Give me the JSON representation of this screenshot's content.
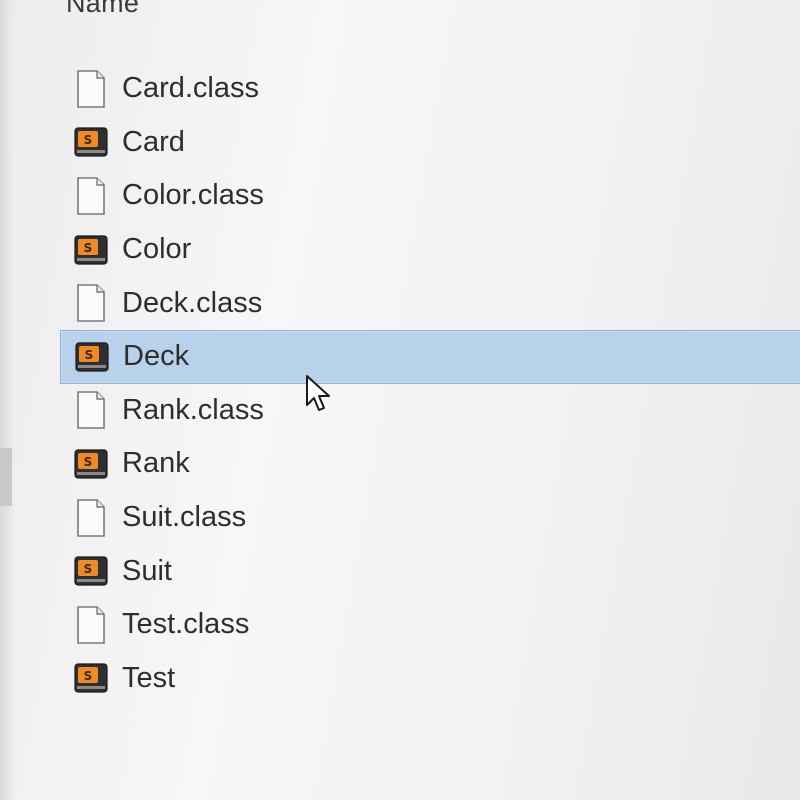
{
  "list_header": {
    "name_label": "Name"
  },
  "files": [
    {
      "name": "Card.class",
      "icon": "blank-file-icon",
      "selected": false
    },
    {
      "name": "Card",
      "icon": "sublime-file-icon",
      "selected": false
    },
    {
      "name": "Color.class",
      "icon": "blank-file-icon",
      "selected": false
    },
    {
      "name": "Color",
      "icon": "sublime-file-icon",
      "selected": false
    },
    {
      "name": "Deck.class",
      "icon": "blank-file-icon",
      "selected": false
    },
    {
      "name": "Deck",
      "icon": "sublime-file-icon",
      "selected": true
    },
    {
      "name": "Rank.class",
      "icon": "blank-file-icon",
      "selected": false
    },
    {
      "name": "Rank",
      "icon": "sublime-file-icon",
      "selected": false
    },
    {
      "name": "Suit.class",
      "icon": "blank-file-icon",
      "selected": false
    },
    {
      "name": "Suit",
      "icon": "sublime-file-icon",
      "selected": false
    },
    {
      "name": "Test.class",
      "icon": "blank-file-icon",
      "selected": false
    },
    {
      "name": "Test",
      "icon": "sublime-file-icon",
      "selected": false
    }
  ],
  "colors": {
    "selection": "#b9d2eb",
    "selection_border": "#8fb3d9",
    "sublime_icon_orange": "#f08a24"
  }
}
